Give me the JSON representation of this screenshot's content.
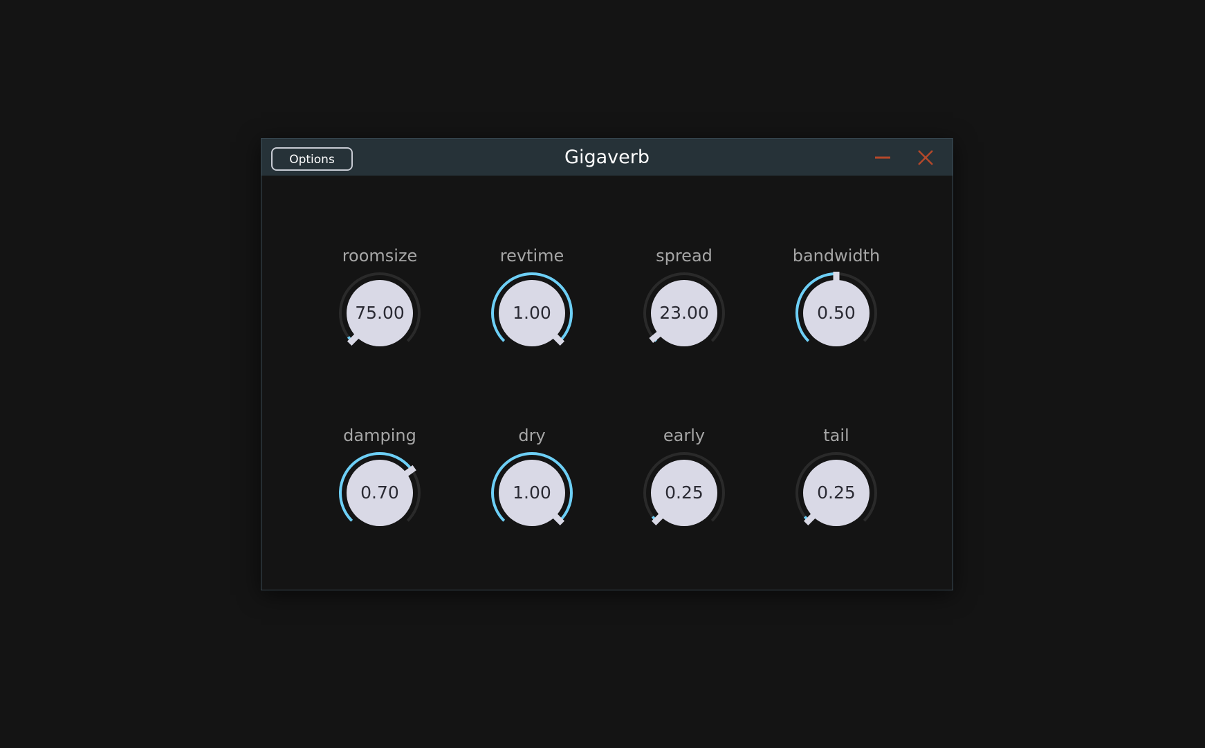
{
  "window": {
    "title": "Gigaverb",
    "options_label": "Options",
    "minimize_icon": "minimize-icon",
    "close_icon": "close-icon"
  },
  "colors": {
    "background": "#141414",
    "titlebar": "#263238",
    "arc_active": "#6dcff6",
    "arc_track": "#2a2a2a",
    "knob_face": "#d9d9e6",
    "pointer": "#d9d9e6",
    "label": "#a6a6a6",
    "window_controls": "#b5482a"
  },
  "knobs": [
    {
      "label": "roomsize",
      "value": "75.00",
      "position": 0.0
    },
    {
      "label": "revtime",
      "value": "1.00",
      "position": 1.0
    },
    {
      "label": "spread",
      "value": "23.00",
      "position": 0.02
    },
    {
      "label": "bandwidth",
      "value": "0.50",
      "position": 0.5
    },
    {
      "label": "damping",
      "value": "0.70",
      "position": 0.7
    },
    {
      "label": "dry",
      "value": "1.00",
      "position": 1.0
    },
    {
      "label": "early",
      "value": "0.25",
      "position": 0.0
    },
    {
      "label": "tail",
      "value": "0.25",
      "position": 0.0
    }
  ]
}
